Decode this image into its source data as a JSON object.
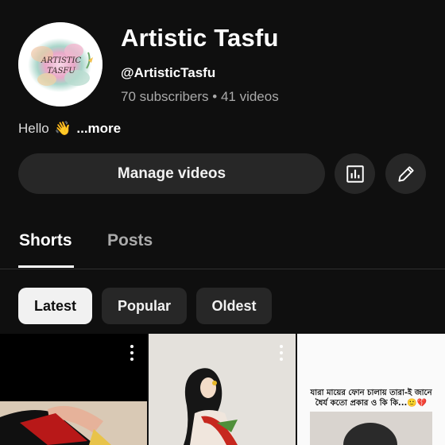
{
  "channel": {
    "avatar_text_line1": "ARTISTIC",
    "avatar_text_line2": "TASFU",
    "title": "Artistic Tasfu",
    "handle": "@ArtisticTasfu",
    "meta": "70 subscribers • 41 videos",
    "description": "Hello",
    "description_emoji": "👋",
    "more_label": "...more"
  },
  "actions": {
    "manage_label": "Manage videos",
    "analytics_icon": "analytics-icon",
    "edit_icon": "pencil-icon"
  },
  "tabs": [
    {
      "label": "Shorts",
      "selected": true
    },
    {
      "label": "Posts",
      "selected": false
    }
  ],
  "chips": [
    {
      "label": "Latest",
      "selected": true
    },
    {
      "label": "Popular",
      "selected": false
    },
    {
      "label": "Oldest",
      "selected": false
    }
  ],
  "shorts": [
    {
      "icon": "more-vert-icon"
    },
    {
      "icon": "more-vert-icon"
    },
    {
      "caption": "যারা মায়ের ফোন চালায় তারা-ই জানে ধৈর্য কতো প্রকার ও কি কি...🙂💔"
    }
  ],
  "colors": {
    "background": "#0f0f0f",
    "button_bg": "#272727",
    "secondary_text": "#aaaaaa",
    "chip_selected_bg": "#f1f1f1"
  }
}
